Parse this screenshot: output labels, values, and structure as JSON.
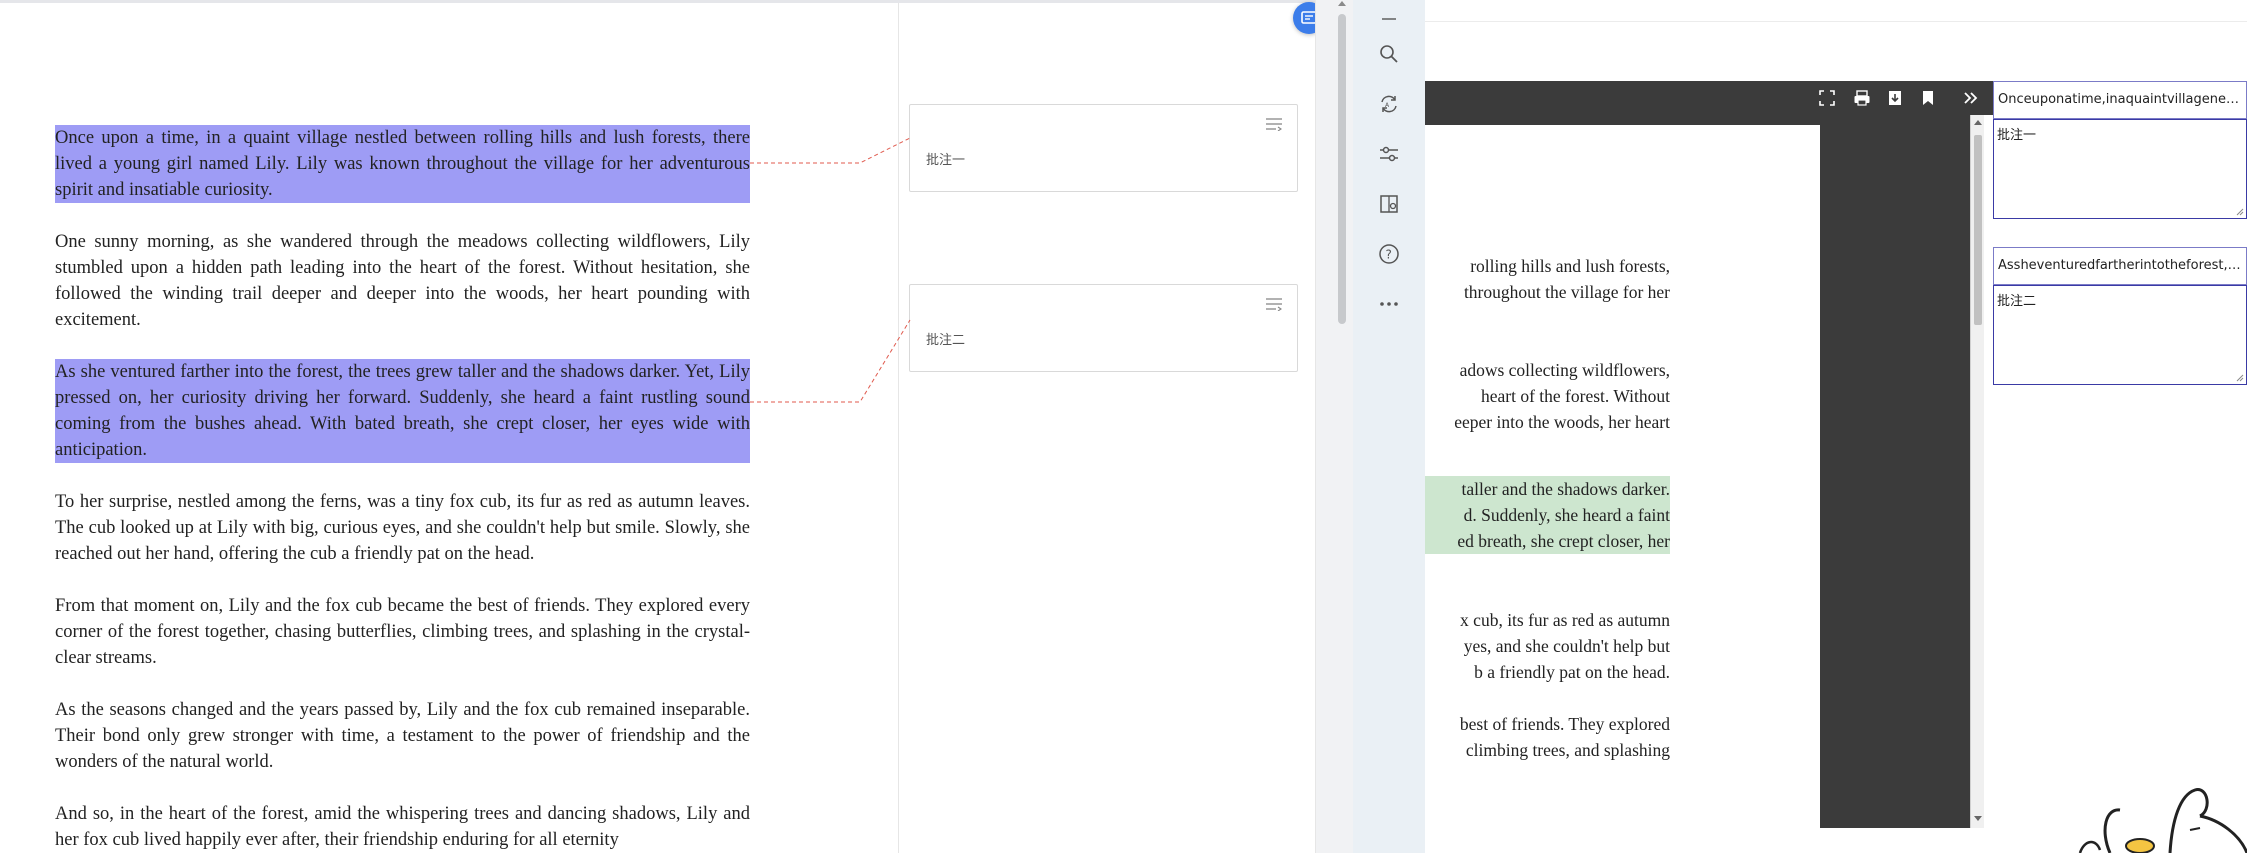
{
  "document": {
    "paragraphs": [
      "Once upon a time, in a quaint village nestled between rolling hills and lush forests, there lived a young girl named Lily. Lily was known throughout the village for her adventurous spirit and insatiable curiosity.",
      "One sunny morning, as she wandered through the meadows collecting wildflowers, Lily stumbled upon a hidden path leading into the heart of the forest. Without hesitation, she followed the winding trail deeper and deeper into the woods, her heart pounding with excitement.",
      "As she ventured farther into the forest, the trees grew taller and the shadows darker. Yet, Lily pressed on, her curiosity driving her forward. Suddenly, she heard a faint rustling sound coming from the bushes ahead. With bated breath, she crept closer, her eyes wide with anticipation.",
      "To her surprise, nestled among the ferns, was a tiny fox cub, its fur as red as autumn leaves. The cub looked up at Lily with big, curious eyes, and she couldn't help but smile. Slowly, she reached out her hand, offering the cub a friendly pat on the head.",
      "From that moment on, Lily and the fox cub became the best of friends. They explored every corner of the forest together, chasing butterflies, climbing trees, and splashing in the crystal-clear streams.",
      "As the seasons changed and the years passed by, Lily and the fox cub remained inseparable. Their bond only grew stronger with time, a testament to the power of friendship and the wonders of the natural world.",
      "And so, in the heart of the forest, amid the whispering trees and dancing shadows, Lily and her fox cub lived happily ever after, their friendship enduring for all eternity"
    ]
  },
  "comments": [
    {
      "text": "批注一"
    },
    {
      "text": "批注二"
    }
  ],
  "toolbar": {
    "icons": [
      "minimize-icon",
      "search-icon",
      "sync-icon",
      "sliders-icon",
      "book-icon",
      "help-icon",
      "more-icon"
    ]
  },
  "viewer": {
    "lines": [
      "rolling hills and lush forests,",
      "throughout the village for her",
      "adows collecting wildflowers,",
      "heart of the forest. Without",
      "eeper into the woods, her heart",
      "taller and the shadows darker.",
      "d. Suddenly, she heard a faint",
      "ed breath, she crept closer, her",
      "x cub, its fur as red as autumn",
      "yes, and she couldn't help but",
      "b a friendly pat on the head.",
      "best of friends. They explored",
      "climbing trees, and splashing"
    ],
    "toolbar_icons": [
      "fullscreen-icon",
      "print-icon",
      "download-icon",
      "bookmark-icon",
      "expand-icon"
    ]
  },
  "annotations": [
    {
      "title": "Onceuponatime,inaquaintvillagenestl…",
      "text": "批注一"
    },
    {
      "title": "Assheventuredfartherintotheforest,the…",
      "text": "批注二"
    }
  ],
  "colors": {
    "highlight": "#9e9cf5",
    "viewer_highlight": "#cde6cf",
    "accent": "#3c7dea",
    "connector": "#e05a4e"
  }
}
